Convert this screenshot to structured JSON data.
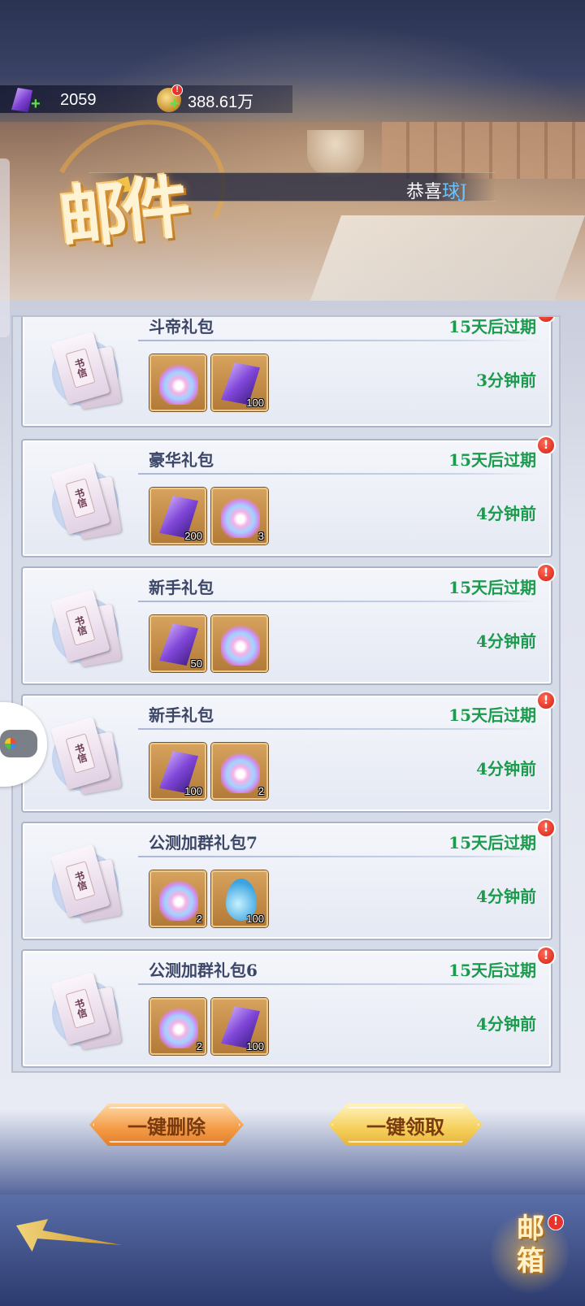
{
  "header": {
    "gems": "2059",
    "coins": "388.61万",
    "title": "邮件",
    "notice": "恭喜",
    "notice_highlight": "球J"
  },
  "mails": [
    {
      "title": "斗帝礼包",
      "expire": "15天后过期",
      "time": "3分钟前",
      "envelope_label": "书信",
      "items": [
        {
          "icon": "lotus-icon",
          "qty": ""
        },
        {
          "icon": "gem-icon",
          "qty": "100"
        }
      ]
    },
    {
      "title": "豪华礼包",
      "expire": "15天后过期",
      "time": "4分钟前",
      "envelope_label": "书信",
      "items": [
        {
          "icon": "gem-icon",
          "qty": "200"
        },
        {
          "icon": "lotus-icon",
          "qty": "3"
        }
      ]
    },
    {
      "title": "新手礼包",
      "expire": "15天后过期",
      "time": "4分钟前",
      "envelope_label": "书信",
      "items": [
        {
          "icon": "gem-icon",
          "qty": "50"
        },
        {
          "icon": "lotus-icon",
          "qty": ""
        }
      ]
    },
    {
      "title": "新手礼包",
      "expire": "15天后过期",
      "time": "4分钟前",
      "envelope_label": "书信",
      "items": [
        {
          "icon": "gem-icon",
          "qty": "100"
        },
        {
          "icon": "lotus-icon",
          "qty": "2"
        }
      ]
    },
    {
      "title": "公测加群礼包7",
      "expire": "15天后过期",
      "time": "4分钟前",
      "envelope_label": "书信",
      "items": [
        {
          "icon": "lotus-icon",
          "qty": "2"
        },
        {
          "icon": "water-drop-icon",
          "qty": "100"
        }
      ]
    },
    {
      "title": "公测加群礼包6",
      "expire": "15天后过期",
      "time": "4分钟前",
      "envelope_label": "书信",
      "items": [
        {
          "icon": "lotus-icon",
          "qty": "2"
        },
        {
          "icon": "gem-icon",
          "qty": "100"
        }
      ]
    }
  ],
  "buttons": {
    "delete_all": "一键删除",
    "claim_all": "一键领取"
  },
  "mailbox_label": "邮箱",
  "colors": {
    "expire_green": "#1c9a4e",
    "title_text": "#3c4666",
    "alert_red": "#d21d12"
  }
}
